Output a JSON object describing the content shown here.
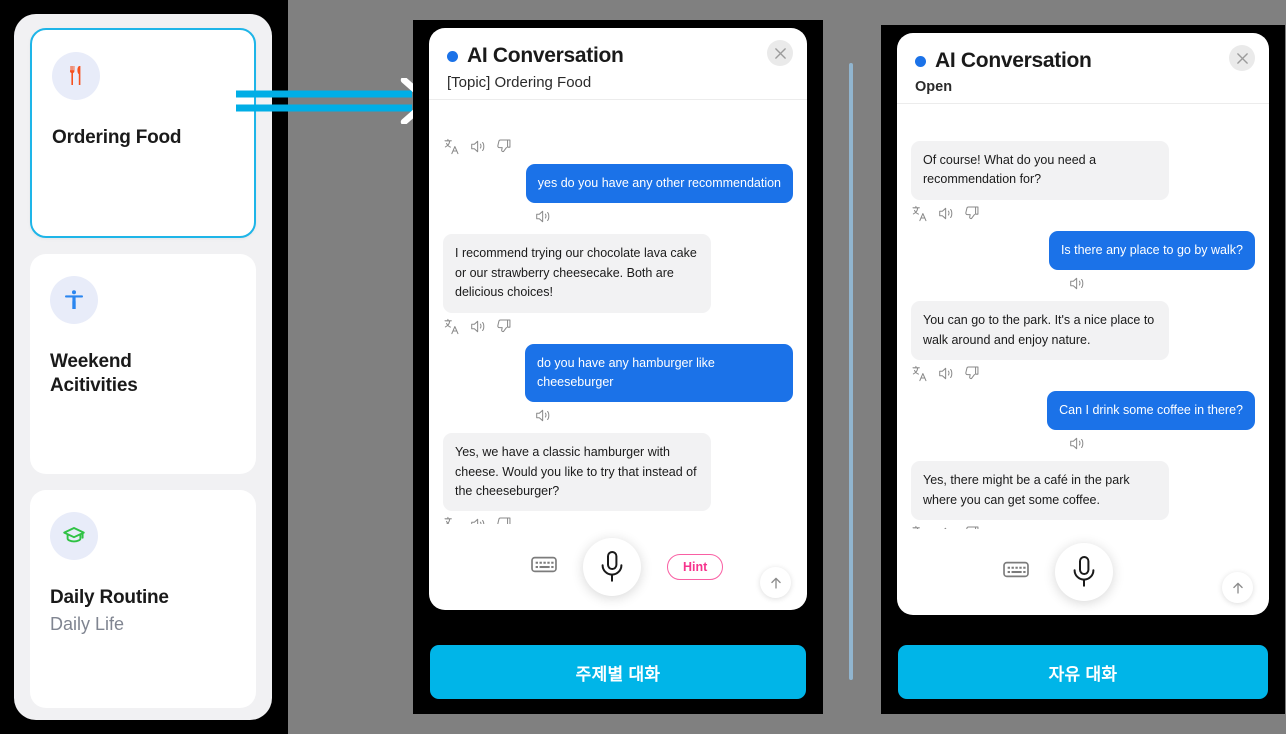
{
  "sidebar": {
    "topics": [
      {
        "icon": "cutlery-icon",
        "title": "Ordering Food",
        "subtitle": "",
        "selected": true,
        "icon_color": "#f5501e"
      },
      {
        "icon": "accessibility-icon",
        "title": "Weekend\nAcitivities",
        "subtitle": "",
        "selected": false,
        "icon_color": "#2b86f0"
      },
      {
        "icon": "graduation-cap-icon",
        "title": "Daily Routine",
        "subtitle": "Daily Life",
        "selected": false,
        "icon_color": "#2fc244"
      }
    ]
  },
  "annotation": {
    "arrow": "double-line-arrow-right",
    "color": "#00aee6"
  },
  "topic_phone": {
    "header": {
      "title": "AI Conversation",
      "subtitle": "[Topic] Ordering Food",
      "status_dot_color": "#1b72e8",
      "close_label": "close-icon"
    },
    "messages": [
      {
        "sender": "user",
        "text": "yes do you have any other recommendation",
        "actions": [
          "speaker-icon"
        ]
      },
      {
        "sender": "ai",
        "text": "I recommend trying our chocolate lava cake or our strawberry cheesecake. Both are delicious choices!",
        "actions": [
          "translate-icon",
          "speaker-icon",
          "thumbs-down-icon"
        ]
      },
      {
        "sender": "user",
        "text": "do you have any  hamburger like cheeseburger",
        "actions": [
          "speaker-icon"
        ]
      },
      {
        "sender": "ai",
        "text": "Yes, we have a classic hamburger with cheese. Would you like to try that instead of the cheeseburger?",
        "actions": [
          "translate-icon",
          "speaker-icon",
          "thumbs-down-icon"
        ]
      }
    ],
    "leading_actions": [
      "translate-icon",
      "speaker-icon",
      "thumbs-down-icon"
    ],
    "controls": {
      "keyboard": "keyboard-icon",
      "mic": "microphone-icon",
      "hint_label": "Hint",
      "scroll_top": "arrow-up-icon"
    },
    "cta_label": "주제별 대화"
  },
  "open_phone": {
    "header": {
      "title": "AI Conversation",
      "subtitle": "Open",
      "status_dot_color": "#1b72e8",
      "close_label": "close-icon"
    },
    "messages": [
      {
        "sender": "ai",
        "text": "Of course! What do you need a recommendation for?",
        "actions": [
          "translate-icon",
          "speaker-icon",
          "thumbs-down-icon"
        ]
      },
      {
        "sender": "user",
        "text": "Is there any place to go by walk?",
        "actions": [
          "speaker-icon"
        ]
      },
      {
        "sender": "ai",
        "text": "You can go to the park. It's a nice place to walk around and enjoy nature.",
        "actions": [
          "translate-icon",
          "speaker-icon",
          "thumbs-down-icon"
        ]
      },
      {
        "sender": "user",
        "text": "Can I drink some coffee in there?",
        "actions": [
          "speaker-icon"
        ]
      },
      {
        "sender": "ai",
        "text": "Yes, there might be a café in the park where you can get some coffee.",
        "actions": [
          "translate-icon",
          "speaker-icon",
          "thumbs-down-icon"
        ]
      }
    ],
    "controls": {
      "keyboard": "keyboard-icon",
      "mic": "microphone-icon",
      "scroll_top": "arrow-up-icon"
    },
    "cta_label": "자유 대화"
  },
  "colors": {
    "accent_cyan": "#00b5e8",
    "user_bubble": "#1b72e8",
    "ai_bubble": "#f2f2f3",
    "hint_pink": "#f6348d",
    "backdrop_grey": "#808080",
    "device_black": "#000000"
  }
}
